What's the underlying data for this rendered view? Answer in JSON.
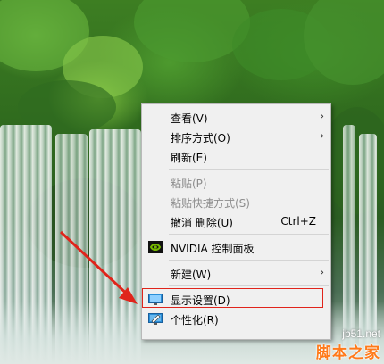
{
  "menu": {
    "items": [
      {
        "label": "查看(V)",
        "submenu": true
      },
      {
        "label": "排序方式(O)",
        "submenu": true
      },
      {
        "label": "刷新(E)"
      },
      {
        "label": "粘贴(P)",
        "disabled": true
      },
      {
        "label": "粘贴快捷方式(S)",
        "disabled": true
      },
      {
        "label": "撤消 删除(U)",
        "shortcut": "Ctrl+Z"
      },
      {
        "label": "NVIDIA 控制面板",
        "icon": "nvidia-icon"
      },
      {
        "label": "新建(W)",
        "submenu": true
      },
      {
        "label": "显示设置(D)",
        "icon": "display-icon",
        "highlighted": true
      },
      {
        "label": "个性化(R)",
        "icon": "personalize-icon"
      }
    ],
    "submenu_arrow": "›"
  },
  "annotation": {
    "color": "#e0241b"
  },
  "watermark": {
    "site": "jb51.net",
    "name": "脚本之家"
  }
}
